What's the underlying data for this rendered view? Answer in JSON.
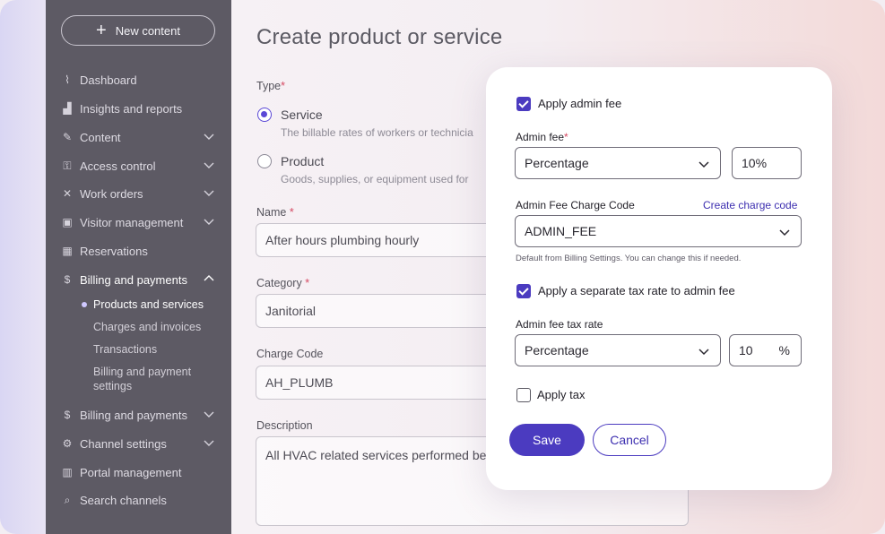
{
  "sidebar": {
    "new_button": "New content",
    "items": [
      {
        "icon": "pulse-icon",
        "glyph": "⌇",
        "label": "Dashboard"
      },
      {
        "icon": "chart-icon",
        "glyph": "▟",
        "label": "Insights and reports"
      },
      {
        "icon": "edit-icon",
        "glyph": "✎",
        "label": "Content"
      },
      {
        "icon": "key-icon",
        "glyph": "⚿",
        "label": "Access control"
      },
      {
        "icon": "tools-icon",
        "glyph": "✕",
        "label": "Work orders"
      },
      {
        "icon": "id-card-icon",
        "glyph": "▣",
        "label": "Visitor management"
      },
      {
        "icon": "calendar-icon",
        "glyph": "▦",
        "label": "Reservations"
      },
      {
        "icon": "dollar-icon",
        "glyph": "$",
        "label": "Billing and payments"
      },
      {
        "icon": "dollar-icon",
        "glyph": "$",
        "label": "Billing and payments"
      },
      {
        "icon": "gear-icon",
        "glyph": "⚙",
        "label": "Channel settings"
      },
      {
        "icon": "building-icon",
        "glyph": "▥",
        "label": "Portal management"
      },
      {
        "icon": "search-icon",
        "glyph": "⌕",
        "label": "Search channels"
      }
    ],
    "sub_items": [
      "Products and services",
      "Charges and invoices",
      "Transactions",
      "Billing and payment settings"
    ]
  },
  "form": {
    "title": "Create product or service",
    "type_label": "Type",
    "service_title": "Service",
    "service_desc": "The billable rates of workers or technicia",
    "product_title": "Product",
    "product_desc": "Goods, supplies, or equipment used for",
    "name_label": "Name",
    "name_value": "After hours plumbing hourly",
    "category_label": "Category",
    "category_value": "Janitorial",
    "charge_code_label": "Charge Code",
    "charge_code_value": "AH_PLUMB",
    "description_label": "Description",
    "description_value": "All HVAC related services performed bet",
    "required_mark": "*"
  },
  "modal": {
    "apply_admin_fee": "Apply admin fee",
    "admin_fee_label": "Admin fee",
    "admin_fee_type": "Percentage",
    "admin_fee_value": "10%",
    "charge_code_label": "Admin Fee Charge Code",
    "create_charge_code": "Create charge code",
    "charge_code_value": "ADMIN_FEE",
    "charge_code_hint": "Default from Billing Settings. You can change this if needed.",
    "apply_separate_tax": "Apply a separate tax rate to admin fee",
    "tax_rate_label": "Admin fee tax rate",
    "tax_rate_type": "Percentage",
    "tax_rate_value": "10",
    "tax_rate_unit": "%",
    "apply_tax": "Apply tax",
    "save": "Save",
    "cancel": "Cancel"
  },
  "colors": {
    "accent": "#4b3bc0",
    "sidebar": "#5d5a64",
    "required": "#d64a63"
  }
}
